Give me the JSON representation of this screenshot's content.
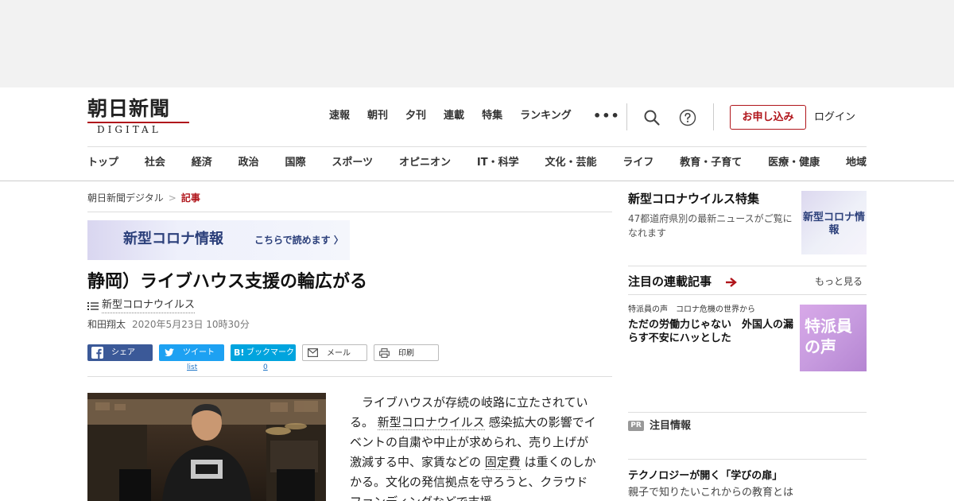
{
  "logo": {
    "main": "朝日新聞",
    "sub": "DIGITAL"
  },
  "topnav": [
    "速報",
    "朝刊",
    "夕刊",
    "連載",
    "特集",
    "ランキング"
  ],
  "more": "•••",
  "subscribe": "お申し込み",
  "login": "ログイン",
  "mainnav": [
    "トップ",
    "社会",
    "経済",
    "政治",
    "国際",
    "スポーツ",
    "オピニオン",
    "IT・科学",
    "文化・芸能",
    "ライフ",
    "教育・子育て",
    "医療・健康",
    "地域"
  ],
  "breadcrumb": {
    "home": "朝日新聞デジタル",
    "sep": ">",
    "current": "記事"
  },
  "corona_banner": {
    "title": "新型コロナ情報",
    "sub": "こちらで読めます 〉"
  },
  "article": {
    "headline": "静岡）ライブハウス支援の輪広がる",
    "tag": "新型コロナウイルス",
    "author": "和田翔太",
    "date": "2020年5月23日 10時30分",
    "body_1": "ライブハウスが存続の岐路に立たされている。",
    "body_link1": "新型コロナウイルス",
    "body_2": "感染拡大の影響でイベントの自粛や中止が求められ、売り上げが激減する中、家賃などの",
    "body_link2": "固定費",
    "body_3": "は重くのしかかる。文化の発信拠点を守ろうと、クラウドファンディングなどで支援"
  },
  "share": {
    "facebook": "シェア",
    "twitter": "ツイート",
    "twitter_count": "list",
    "hatena": "ブックマーク",
    "hatena_icon": "B!",
    "hatena_count": "0",
    "mail": "メール",
    "print": "印刷"
  },
  "sidebar": {
    "corona_title": "新型コロナウイルス特集",
    "corona_desc": "47都道府県別の最新ニュースがご覧になれます",
    "corona_thumb": "新型コロナ情報",
    "rensai_title": "注目の連載記事",
    "rensai_more": "もっと見る",
    "rensai_kicker": "特派員の声　コロナ危機の世界から",
    "rensai_head": "ただの労働力じゃない　外国人の漏らす不安にハッとした",
    "tokuha_thumb": "特派員の声",
    "pr_badge": "PR",
    "pr_title": "注目情報",
    "pr_head": "テクノロジーが開く「学びの扉」",
    "pr_desc": "親子で知りたいこれからの教育とは"
  },
  "colors": {
    "brand_red": "#b0151b",
    "facebook": "#3b5998",
    "twitter": "#1da1f2",
    "hatena": "#00a4de"
  }
}
